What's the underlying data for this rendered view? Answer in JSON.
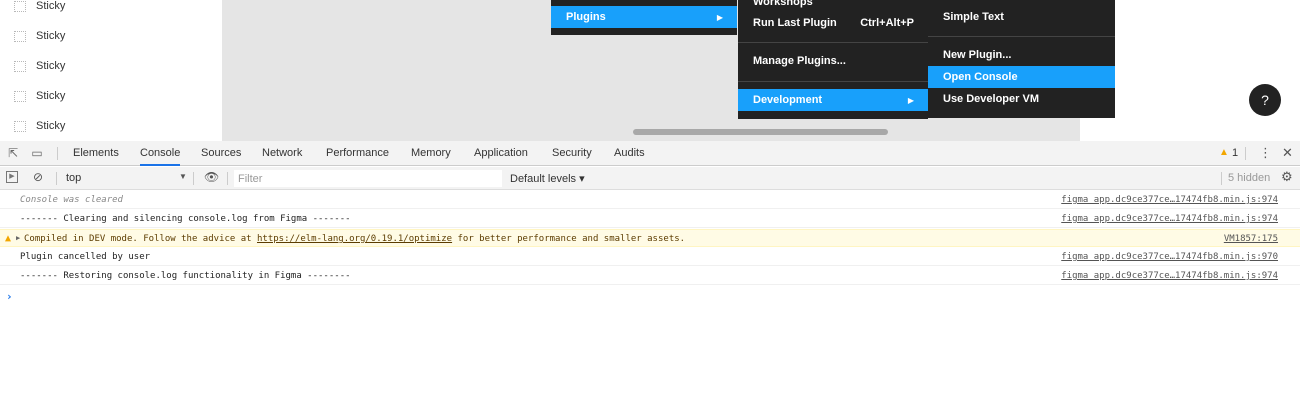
{
  "layers": [
    {
      "label": "Sticky"
    },
    {
      "label": "Sticky"
    },
    {
      "label": "Sticky"
    },
    {
      "label": "Sticky"
    },
    {
      "label": "Sticky"
    }
  ],
  "menu1": {
    "plugins_label": "Plugins"
  },
  "menu2": {
    "workshops_label": "Workshops",
    "run_last_label": "Run Last Plugin",
    "run_last_shortcut": "Ctrl+Alt+P",
    "manage_label": "Manage Plugins...",
    "development_label": "Development"
  },
  "menu3": {
    "top_label": "Simple Text",
    "new_plugin_label": "New Plugin...",
    "open_console_label": "Open Console",
    "use_vm_label": "Use Developer VM"
  },
  "help": {
    "label": "?"
  },
  "devtools": {
    "tabs": [
      "Elements",
      "Console",
      "Sources",
      "Network",
      "Performance",
      "Memory",
      "Application",
      "Security",
      "Audits"
    ],
    "warning_count": "1",
    "context": "top",
    "filter_placeholder": "Filter",
    "levels_label": "Default levels ▾",
    "hidden_label": "5 hidden"
  },
  "console": {
    "messages": [
      {
        "text": "Console was cleared",
        "source": "figma_app.dc9ce377ce…17474fb8.min.js:974"
      },
      {
        "text": "------- Clearing and silencing console.log from Figma -------",
        "source": "figma_app.dc9ce377ce…17474fb8.min.js:974"
      },
      {
        "prefix": "Compiled in DEV mode. Follow the advice at ",
        "link": "https://elm-lang.org/0.19.1/optimize",
        "suffix": " for better performance and smaller assets.",
        "source": "VM1857:175"
      },
      {
        "text": "Plugin cancelled by user",
        "source": "figma_app.dc9ce377ce…17474fb8.min.js:970"
      },
      {
        "text": "------- Restoring console.log functionality in Figma --------",
        "source": "figma_app.dc9ce377ce…17474fb8.min.js:974"
      }
    ]
  },
  "colors": {
    "accent": "#18a0fb",
    "menu_bg": "#222222",
    "warning": "#fffbe5",
    "devtools_blue": "#1a73e8"
  }
}
